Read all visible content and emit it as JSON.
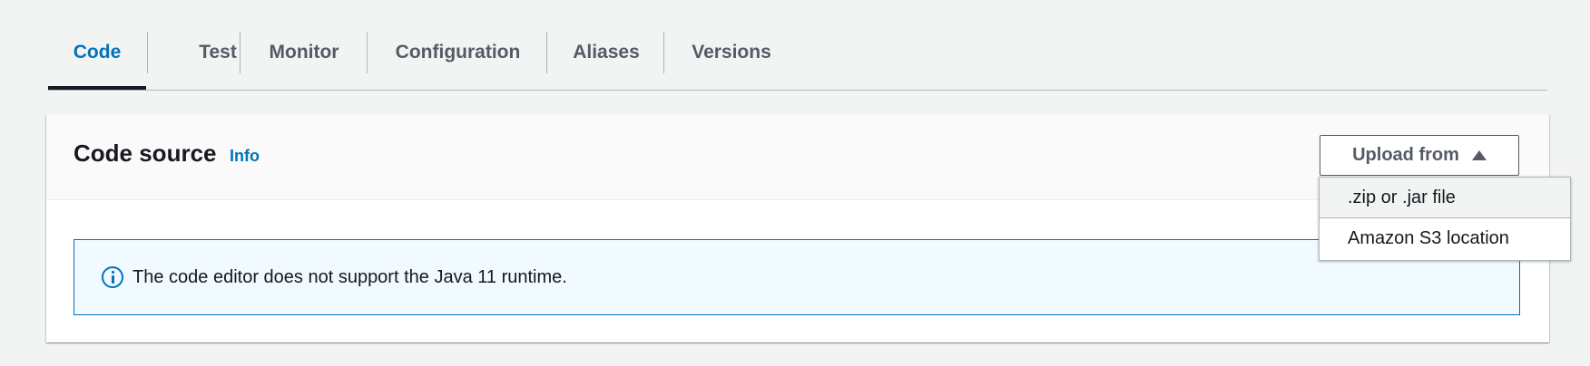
{
  "tabs": [
    {
      "label": "Code",
      "active": true
    },
    {
      "label": "Test"
    },
    {
      "label": "Monitor"
    },
    {
      "label": "Configuration"
    },
    {
      "label": "Aliases"
    },
    {
      "label": "Versions"
    }
  ],
  "code_source": {
    "title": "Code source",
    "info_link": "Info",
    "upload_button": {
      "label": "Upload from",
      "icon": "caret-up-icon"
    },
    "upload_menu": [
      {
        "label": ".zip or .jar file"
      },
      {
        "label": "Amazon S3 location"
      }
    ],
    "alert": {
      "icon": "info-icon",
      "text": "The code editor does not support the Java 11 runtime."
    }
  },
  "colors": {
    "accent": "#0073bb",
    "page_bg": "#f2f3f3",
    "alert_bg": "#f1faff",
    "text": "#16191f",
    "muted_text": "#545b64"
  }
}
